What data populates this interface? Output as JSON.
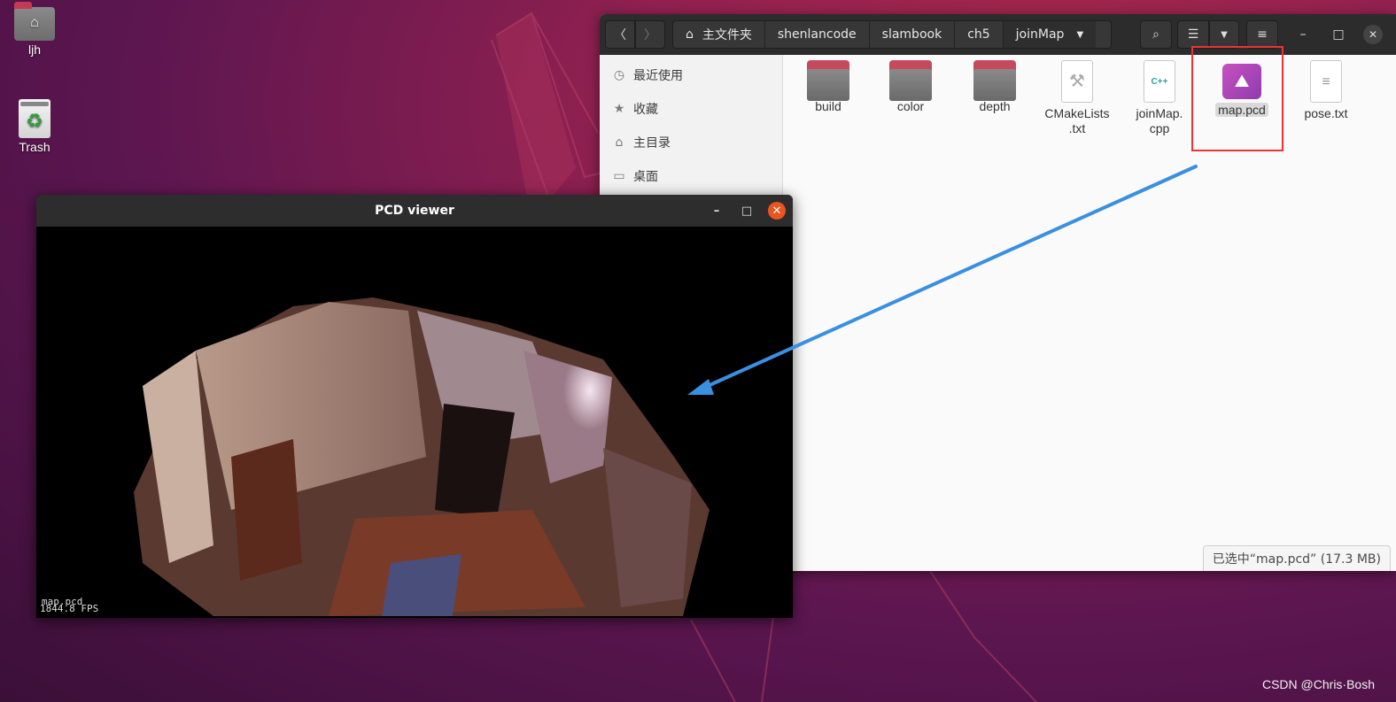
{
  "desktop": {
    "icons": [
      {
        "label": "ljh",
        "icon": "home-folder-icon"
      },
      {
        "label": "Trash",
        "icon": "trash-icon"
      }
    ]
  },
  "file_manager": {
    "breadcrumbs": [
      "主文件夹",
      "shenlancode",
      "slambook",
      "ch5",
      "joinMap"
    ],
    "sidebar": [
      {
        "label": "最近使用",
        "icon": "clock-icon"
      },
      {
        "label": "收藏",
        "icon": "star-icon"
      },
      {
        "label": "主目录",
        "icon": "home-icon"
      },
      {
        "label": "桌面",
        "icon": "desktop-icon"
      }
    ],
    "files": [
      {
        "name": "build",
        "type": "folder"
      },
      {
        "name": "color",
        "type": "folder"
      },
      {
        "name": "depth",
        "type": "folder"
      },
      {
        "name": "CMakeLists\n.txt",
        "type": "cmake"
      },
      {
        "name": "joinMap.\ncpp",
        "type": "cpp",
        "badge": "C++"
      },
      {
        "name": "map.pcd",
        "type": "pcd",
        "selected": true
      },
      {
        "name": "pose.txt",
        "type": "text"
      }
    ],
    "status": "已选中“map.pcd” (17.3 MB)"
  },
  "pcd_viewer": {
    "title": "PCD viewer",
    "overlay_fps": "1844.8 FPS",
    "overlay_file": "map.pcd"
  },
  "annotation": {
    "arrow_color": "#3a8fe0",
    "box_color": "#e33333"
  },
  "watermark": "CSDN @Chris·Bosh"
}
